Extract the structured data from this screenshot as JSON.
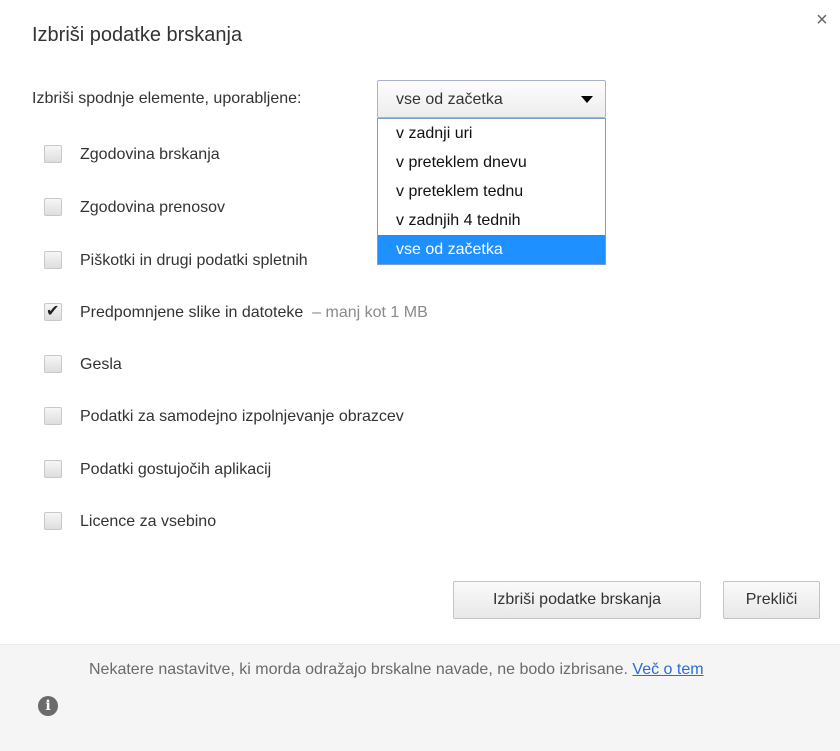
{
  "dialog": {
    "title": "Izbriši podatke brskanja",
    "close_icon": "close-icon"
  },
  "range": {
    "label": "Izbriši spodnje elemente, uporabljene:",
    "selected": "vse od začetka",
    "options": [
      "v zadnji uri",
      "v preteklem dnevu",
      "v preteklem tednu",
      "v zadnjih 4 tednih",
      "vse od začetka"
    ]
  },
  "items": [
    {
      "label": "Zgodovina brskanja",
      "extra": "",
      "checked": false
    },
    {
      "label": "Zgodovina prenosov",
      "extra": "",
      "checked": false
    },
    {
      "label": "Piškotki in drugi podatki spletnih",
      "extra": "",
      "checked": false
    },
    {
      "label": "Predpomnjene slike in datoteke",
      "extra": "–  manj kot 1 MB",
      "checked": true
    },
    {
      "label": "Gesla",
      "extra": "",
      "checked": false
    },
    {
      "label": "Podatki za samodejno izpolnjevanje obrazcev",
      "extra": "",
      "checked": false
    },
    {
      "label": "Podatki gostujočih aplikacij",
      "extra": "",
      "checked": false
    },
    {
      "label": "Licence za vsebino",
      "extra": "",
      "checked": false
    }
  ],
  "buttons": {
    "delete": "Izbriši podatke brskanja",
    "cancel": "Prekliči"
  },
  "footer": {
    "text": "Nekatere nastavitve, ki morda odražajo brskalne navade, ne bodo izbrisane. ",
    "link": "Več o tem",
    "icon": "info-icon"
  }
}
